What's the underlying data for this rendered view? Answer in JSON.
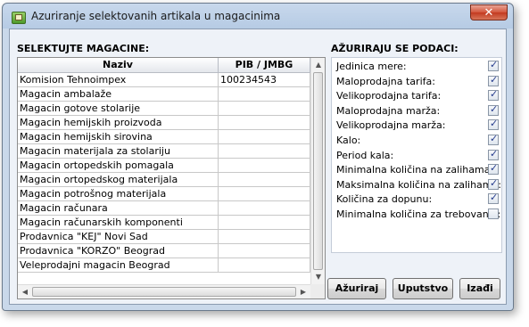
{
  "window": {
    "title": "Azuriranje selektovanih artikala u magacinima",
    "close_glyph": "✕"
  },
  "left": {
    "section_label": "SELEKTUJTE MAGACINE:",
    "columns": [
      "Naziv",
      "PIB / JMBG"
    ],
    "rows": [
      {
        "naziv": "Komision Tehnoimpex",
        "pib": "100234543"
      },
      {
        "naziv": "Magacin ambalaže",
        "pib": ""
      },
      {
        "naziv": "Magacin gotove stolarije",
        "pib": ""
      },
      {
        "naziv": "Magacin hemijskih proizvoda",
        "pib": ""
      },
      {
        "naziv": "Magacin hemijskih sirovina",
        "pib": ""
      },
      {
        "naziv": "Magacin materijala za stolariju",
        "pib": ""
      },
      {
        "naziv": "Magacin ortopedskih pomagala",
        "pib": ""
      },
      {
        "naziv": "Magacin ortopedskog materijala",
        "pib": ""
      },
      {
        "naziv": "Magacin potrošnog materijala",
        "pib": ""
      },
      {
        "naziv": "Magacin računara",
        "pib": ""
      },
      {
        "naziv": "Magacin računarskih komponenti",
        "pib": ""
      },
      {
        "naziv": "Prodavnica \"KEJ\" Novi Sad",
        "pib": ""
      },
      {
        "naziv": "Prodavnica \"KORZO\" Beograd",
        "pib": ""
      },
      {
        "naziv": "Veleprodajni magacin Beograd",
        "pib": ""
      }
    ]
  },
  "right": {
    "section_label": "AŽURIRAJU SE PODACI:",
    "options": [
      {
        "label": "Jedinica mere:",
        "checked": true
      },
      {
        "label": "Maloprodajna tarifa:",
        "checked": true
      },
      {
        "label": "Velikoprodajna tarifa:",
        "checked": true
      },
      {
        "label": "Maloprodajna marža:",
        "checked": true
      },
      {
        "label": "Velikoprodajna marža:",
        "checked": true
      },
      {
        "label": "Kalo:",
        "checked": true
      },
      {
        "label": "Period kala:",
        "checked": true
      },
      {
        "label": "Minimalna količina na zalihama:",
        "checked": true
      },
      {
        "label": "Maksimalna količina na zalihama:",
        "checked": true
      },
      {
        "label": "Količina za dopunu:",
        "checked": true
      },
      {
        "label": "Minimalna količina za trebovanje:",
        "checked": false
      }
    ]
  },
  "buttons": {
    "azuriraj": "Ažuriraj",
    "uputstvo": "Uputstvo",
    "izadji": "Izađi"
  },
  "colors": {
    "titlebar": "#b6cbe4",
    "check": "#243a8c",
    "close": "#c23a20"
  }
}
